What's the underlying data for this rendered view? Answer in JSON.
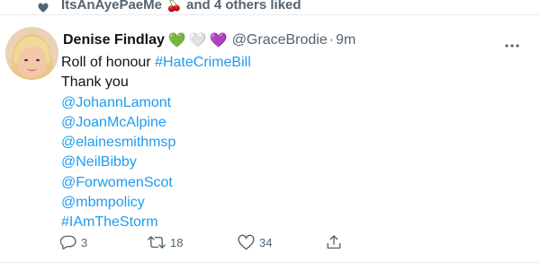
{
  "liked_banner": {
    "text": "ItsAnAyePaeMe 🍒 and 4 others liked",
    "icon": "heart-icon"
  },
  "tweet": {
    "author_name": "Denise Findlay",
    "author_emoji": [
      "💚",
      "🤍",
      "💜"
    ],
    "handle": "@GraceBrodie",
    "separator": "·",
    "time": "9m",
    "body": {
      "line1_text": "Roll of honour ",
      "line1_hashtag": "#HateCrimeBill",
      "line2_text": "Thank you",
      "mentions": [
        "@JohannLamont",
        "@JoanMcAlpine",
        "@elainesmithmsp",
        "@NeilBibby",
        "@ForwomenScot",
        "@mbmpolicy"
      ],
      "hashtag_end": "#IAmTheStorm"
    },
    "actions": {
      "reply_count": "3",
      "retweet_count": "18",
      "like_count": "34"
    }
  },
  "colors": {
    "link": "#1d9bf0",
    "muted": "#536471",
    "text": "#0f1419",
    "divider": "#e6ecf0"
  }
}
